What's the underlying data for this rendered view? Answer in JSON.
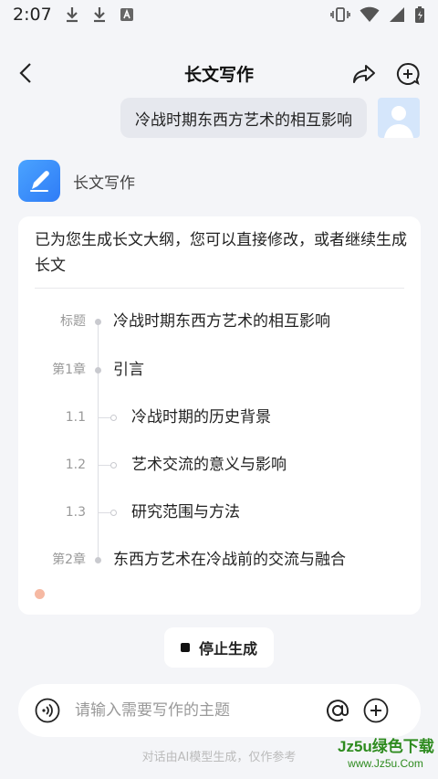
{
  "status_bar": {
    "time": "2:07"
  },
  "header": {
    "title": "长文写作"
  },
  "user_message": {
    "text": "冷战时期东西方艺术的相互影响"
  },
  "bot": {
    "name": "长文写作"
  },
  "answer": {
    "intro": "已为您生成长文大纲，您可以直接修改，或者继续生成长文",
    "outline": [
      {
        "label": "标题",
        "text": "冷战时期东西方艺术的相互影响",
        "level": 0
      },
      {
        "label": "第1章",
        "text": "引言",
        "level": 0
      },
      {
        "label": "1.1",
        "text": "冷战时期的历史背景",
        "level": 1
      },
      {
        "label": "1.2",
        "text": "艺术交流的意义与影响",
        "level": 1
      },
      {
        "label": "1.3",
        "text": "研究范围与方法",
        "level": 1
      },
      {
        "label": "第2章",
        "text": "东西方艺术在冷战前的交流与融合",
        "level": 0
      }
    ]
  },
  "stop_button": {
    "label": "停止生成"
  },
  "input": {
    "placeholder": "请输入需要写作的主题"
  },
  "footer": {
    "note": "对话由AI模型生成，仅作参考"
  },
  "watermark": {
    "main": "Jz5u绿色下载",
    "sub": "www.Jz5u.Com"
  },
  "colors": {
    "accent": "#2f7cf6",
    "background": "#f4f5f8",
    "watermark": "#2e8b1f"
  }
}
